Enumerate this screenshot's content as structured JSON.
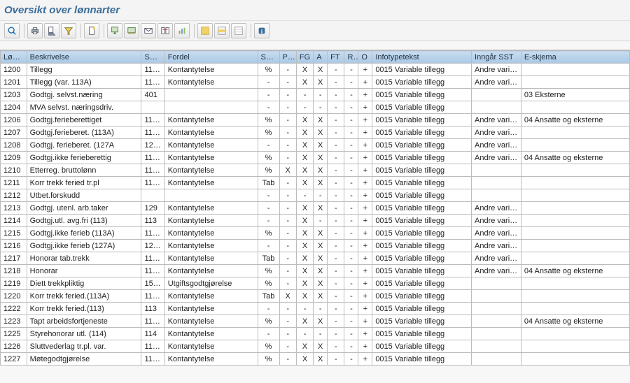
{
  "title": "Oversikt over lønnarter",
  "columns": {
    "lon": "Løn…",
    "beskrivelse": "Beskrivelse",
    "sd": "SD-…",
    "fordel": "Fordel",
    "sk": "Sk…",
    "pg": "PG",
    "fg": "FG",
    "a": "A",
    "ft": "FT",
    "r": "R…",
    "o": "O",
    "infotypetekst": "Infotypetekst",
    "inngar_sst": "Inngår SST",
    "eskjema": "E-skjema"
  },
  "toolbar_icons": [
    "details-icon",
    "print-icon",
    "print-preview-icon",
    "filter-icon",
    "new-doc-icon",
    "export-icon",
    "export-local-icon",
    "mail-icon",
    "change-layout-icon",
    "graph-icon",
    "select-all-icon",
    "select-block-icon",
    "deselect-all-icon",
    "info-icon"
  ],
  "rows": [
    {
      "lon": "1200",
      "besk": "Tillegg",
      "sd": "11…",
      "fordel": "Kontantytelse",
      "sk": "%",
      "pg": "-",
      "fg": "X",
      "a": "X",
      "ft": "-",
      "r": "-",
      "o": "+",
      "it": "0015 Variable tillegg",
      "sst": "Andre vari…",
      "esk": ""
    },
    {
      "lon": "1201",
      "besk": "Tillegg (var. 113A)",
      "sd": "11…",
      "fordel": "Kontantytelse",
      "sk": "-",
      "pg": "-",
      "fg": "X",
      "a": "X",
      "ft": "-",
      "r": "-",
      "o": "+",
      "it": "0015 Variable tillegg",
      "sst": "Andre vari…",
      "esk": ""
    },
    {
      "lon": "1203",
      "besk": "Godtgj. selvst.næring",
      "sd": "401",
      "fordel": "",
      "sk": "-",
      "pg": "-",
      "fg": "-",
      "a": "-",
      "ft": "-",
      "r": "-",
      "o": "+",
      "it": "0015 Variable tillegg",
      "sst": "",
      "esk": "03 Eksterne"
    },
    {
      "lon": "1204",
      "besk": "MVA selvst. næringsdriv.",
      "sd": "",
      "fordel": "",
      "sk": "-",
      "pg": "-",
      "fg": "-",
      "a": "-",
      "ft": "-",
      "r": "-",
      "o": "+",
      "it": "0015 Variable tillegg",
      "sst": "",
      "esk": ""
    },
    {
      "lon": "1206",
      "besk": "Godtgj.ferieberettiget",
      "sd": "11…",
      "fordel": "Kontantytelse",
      "sk": "%",
      "pg": "-",
      "fg": "X",
      "a": "X",
      "ft": "-",
      "r": "-",
      "o": "+",
      "it": "0015 Variable tillegg",
      "sst": "Andre vari…",
      "esk": "04 Ansatte og eksterne"
    },
    {
      "lon": "1207",
      "besk": "Godtgj.ferieberet. (113A)",
      "sd": "11…",
      "fordel": "Kontantytelse",
      "sk": "%",
      "pg": "-",
      "fg": "X",
      "a": "X",
      "ft": "-",
      "r": "-",
      "o": "+",
      "it": "0015 Variable tillegg",
      "sst": "Andre vari…",
      "esk": ""
    },
    {
      "lon": "1208",
      "besk": "Godtgj. ferieberet. (127A",
      "sd": "12…",
      "fordel": "Kontantytelse",
      "sk": "-",
      "pg": "-",
      "fg": "X",
      "a": "X",
      "ft": "-",
      "r": "-",
      "o": "+",
      "it": "0015 Variable tillegg",
      "sst": "Andre vari…",
      "esk": ""
    },
    {
      "lon": "1209",
      "besk": "Godtgj.ikke ferieberettig",
      "sd": "11…",
      "fordel": "Kontantytelse",
      "sk": "%",
      "pg": "-",
      "fg": "X",
      "a": "X",
      "ft": "-",
      "r": "-",
      "o": "+",
      "it": "0015 Variable tillegg",
      "sst": "Andre vari…",
      "esk": "04 Ansatte og eksterne"
    },
    {
      "lon": "1210",
      "besk": "Etterreg. bruttolønn",
      "sd": "11…",
      "fordel": "Kontantytelse",
      "sk": "%",
      "pg": "X",
      "fg": "X",
      "a": "X",
      "ft": "-",
      "r": "-",
      "o": "+",
      "it": "0015 Variable tillegg",
      "sst": "",
      "esk": ""
    },
    {
      "lon": "1211",
      "besk": "Korr trekk  feried tr.pl",
      "sd": "11…",
      "fordel": "Kontantytelse",
      "sk": "Tab",
      "pg": "-",
      "fg": "X",
      "a": "X",
      "ft": "-",
      "r": "-",
      "o": "+",
      "it": "0015 Variable tillegg",
      "sst": "",
      "esk": ""
    },
    {
      "lon": "1212",
      "besk": "Utbet.forskudd",
      "sd": "",
      "fordel": "",
      "sk": "-",
      "pg": "-",
      "fg": "-",
      "a": "-",
      "ft": "-",
      "r": "-",
      "o": "+",
      "it": "0015 Variable tillegg",
      "sst": "",
      "esk": ""
    },
    {
      "lon": "1213",
      "besk": "Godtgj. utenl. arb.taker",
      "sd": "129",
      "fordel": "Kontantytelse",
      "sk": "-",
      "pg": "-",
      "fg": "X",
      "a": "X",
      "ft": "-",
      "r": "-",
      "o": "+",
      "it": "0015 Variable tillegg",
      "sst": "Andre vari…",
      "esk": ""
    },
    {
      "lon": "1214",
      "besk": "Godtgj.utl. avg.fri (113)",
      "sd": "113",
      "fordel": "Kontantytelse",
      "sk": "-",
      "pg": "-",
      "fg": "X",
      "a": "-",
      "ft": "-",
      "r": "-",
      "o": "+",
      "it": "0015 Variable tillegg",
      "sst": "Andre vari…",
      "esk": ""
    },
    {
      "lon": "1215",
      "besk": "Godtgj.ikke ferieb (113A)",
      "sd": "11…",
      "fordel": "Kontantytelse",
      "sk": "%",
      "pg": "-",
      "fg": "X",
      "a": "X",
      "ft": "-",
      "r": "-",
      "o": "+",
      "it": "0015 Variable tillegg",
      "sst": "Andre vari…",
      "esk": ""
    },
    {
      "lon": "1216",
      "besk": "Godtgj.ikke ferieb (127A)",
      "sd": "12…",
      "fordel": "Kontantytelse",
      "sk": "-",
      "pg": "-",
      "fg": "X",
      "a": "X",
      "ft": "-",
      "r": "-",
      "o": "+",
      "it": "0015 Variable tillegg",
      "sst": "Andre vari…",
      "esk": ""
    },
    {
      "lon": "1217",
      "besk": "Honorar tab.trekk",
      "sd": "11…",
      "fordel": "Kontantytelse",
      "sk": "Tab",
      "pg": "-",
      "fg": "X",
      "a": "X",
      "ft": "-",
      "r": "-",
      "o": "+",
      "it": "0015 Variable tillegg",
      "sst": "Andre vari…",
      "esk": ""
    },
    {
      "lon": "1218",
      "besk": "Honorar",
      "sd": "11…",
      "fordel": "Kontantytelse",
      "sk": "%",
      "pg": "-",
      "fg": "X",
      "a": "X",
      "ft": "-",
      "r": "-",
      "o": "+",
      "it": "0015 Variable tillegg",
      "sst": "Andre vari…",
      "esk": "04 Ansatte og eksterne"
    },
    {
      "lon": "1219",
      "besk": "Diett trekkpliktig",
      "sd": "15…",
      "fordel": "Utgiftsgodtgjørelse",
      "sk": "%",
      "pg": "-",
      "fg": "X",
      "a": "X",
      "ft": "-",
      "r": "-",
      "o": "+",
      "it": "0015 Variable tillegg",
      "sst": "",
      "esk": ""
    },
    {
      "lon": "1220",
      "besk": "Korr trekk feried.(113A)",
      "sd": "11…",
      "fordel": "Kontantytelse",
      "sk": "Tab",
      "pg": "X",
      "fg": "X",
      "a": "X",
      "ft": "-",
      "r": "-",
      "o": "+",
      "it": "0015 Variable tillegg",
      "sst": "",
      "esk": ""
    },
    {
      "lon": "1222",
      "besk": "Korr trekk feried.(113)",
      "sd": "113",
      "fordel": "Kontantytelse",
      "sk": "-",
      "pg": "-",
      "fg": "-",
      "a": "-",
      "ft": "-",
      "r": "-",
      "o": "+",
      "it": "0015 Variable tillegg",
      "sst": "",
      "esk": ""
    },
    {
      "lon": "1223",
      "besk": "Tapt arbeidsfortjeneste",
      "sd": "11…",
      "fordel": "Kontantytelse",
      "sk": "%",
      "pg": "-",
      "fg": "X",
      "a": "X",
      "ft": "-",
      "r": "-",
      "o": "+",
      "it": "0015 Variable tillegg",
      "sst": "",
      "esk": "04 Ansatte og eksterne"
    },
    {
      "lon": "1225",
      "besk": "Styrehonorar utl. (114)",
      "sd": "114",
      "fordel": "Kontantytelse",
      "sk": "-",
      "pg": "-",
      "fg": "-",
      "a": "-",
      "ft": "-",
      "r": "-",
      "o": "+",
      "it": "0015 Variable tillegg",
      "sst": "",
      "esk": ""
    },
    {
      "lon": "1226",
      "besk": "Sluttvederlag tr.pl. var.",
      "sd": "11…",
      "fordel": "Kontantytelse",
      "sk": "%",
      "pg": "-",
      "fg": "X",
      "a": "X",
      "ft": "-",
      "r": "-",
      "o": "+",
      "it": "0015 Variable tillegg",
      "sst": "",
      "esk": ""
    },
    {
      "lon": "1227",
      "besk": "Møtegodtgjørelse",
      "sd": "11…",
      "fordel": "Kontantytelse",
      "sk": "%",
      "pg": "-",
      "fg": "X",
      "a": "X",
      "ft": "-",
      "r": "-",
      "o": "+",
      "it": "0015 Variable tillegg",
      "sst": "",
      "esk": ""
    }
  ]
}
